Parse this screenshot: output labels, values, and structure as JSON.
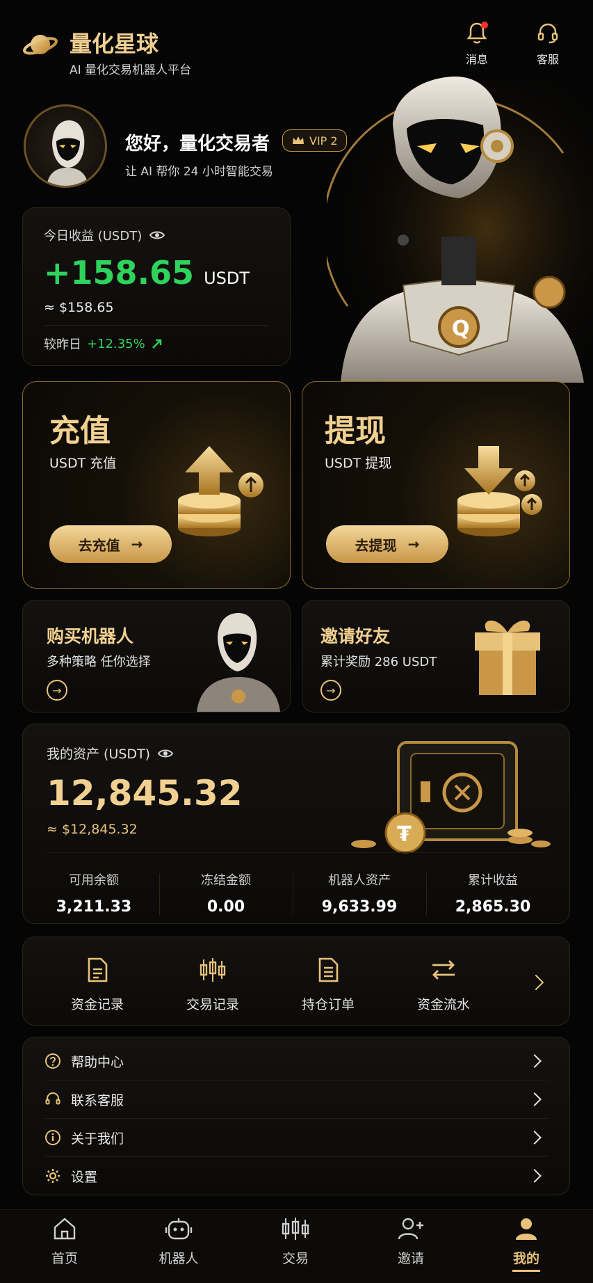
{
  "header": {
    "app_name": "量化星球",
    "subtitle": "AI 量化交易机器人平台",
    "messages_label": "消息",
    "service_label": "客服"
  },
  "profile": {
    "greeting": "您好，量化交易者",
    "vip_label": "VIP 2",
    "tagline": "让 AI 帮你 24 小时智能交易"
  },
  "today_earnings": {
    "label": "今日收益 (USDT)",
    "amount": "+158.65",
    "unit": "USDT",
    "approx": "≈ $158.65",
    "compare_label": "较昨日",
    "compare_value": "+12.35%"
  },
  "actions": {
    "deposit": {
      "title": "充值",
      "subtitle": "USDT 充值",
      "button": "去充值"
    },
    "withdraw": {
      "title": "提现",
      "subtitle": "USDT 提现",
      "button": "去提现"
    }
  },
  "promos": {
    "buy_robot": {
      "title": "购买机器人",
      "subtitle": "多种策略 任你选择"
    },
    "invite": {
      "title": "邀请好友",
      "subtitle": "累计奖励 286 USDT"
    }
  },
  "assets": {
    "label": "我的资产 (USDT)",
    "total": "12,845.32",
    "approx": "≈ $12,845.32",
    "stats": [
      {
        "label": "可用余额",
        "value": "3,211.33"
      },
      {
        "label": "冻结金额",
        "value": "0.00"
      },
      {
        "label": "机器人资产",
        "value": "9,633.99"
      },
      {
        "label": "累计收益",
        "value": "2,865.30"
      }
    ]
  },
  "quick_links": [
    {
      "label": "资金记录",
      "icon": "document-icon"
    },
    {
      "label": "交易记录",
      "icon": "candlestick-icon"
    },
    {
      "label": "持仓订单",
      "icon": "order-icon"
    },
    {
      "label": "资金流水",
      "icon": "transfer-icon"
    }
  ],
  "menu": [
    {
      "label": "帮助中心",
      "icon": "help-icon"
    },
    {
      "label": "联系客服",
      "icon": "headset-icon"
    },
    {
      "label": "关于我们",
      "icon": "info-icon"
    },
    {
      "label": "设置",
      "icon": "gear-icon"
    }
  ],
  "tabbar": [
    {
      "label": "首页",
      "icon": "home-icon"
    },
    {
      "label": "机器人",
      "icon": "robot-icon"
    },
    {
      "label": "交易",
      "icon": "candlestick-icon"
    },
    {
      "label": "邀请",
      "icon": "add-user-icon"
    },
    {
      "label": "我的",
      "icon": "user-icon",
      "active": true
    }
  ],
  "colors": {
    "accent": "#e9c27a",
    "positive": "#2fd35b",
    "background": "#050505",
    "badge": "#ff2d2d"
  }
}
